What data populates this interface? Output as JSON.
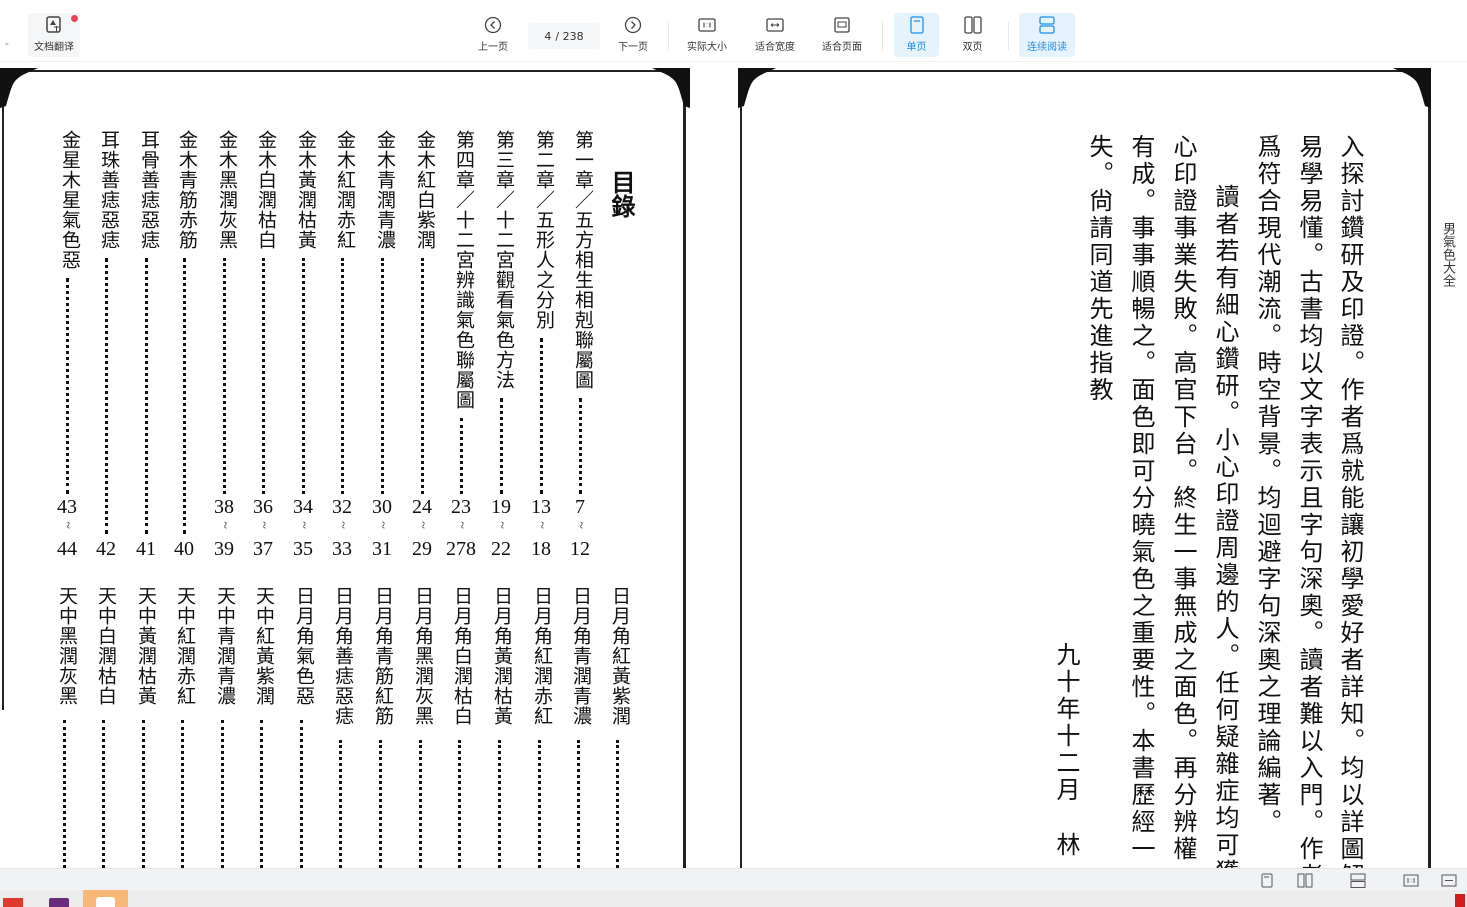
{
  "toolbar": {
    "translate_label": "文档翻译",
    "prev_label": "上一页",
    "current_page": "4",
    "total_pages": "/ 238",
    "next_label": "下一页",
    "actual_size_label": "实际大小",
    "fit_width_label": "适合宽度",
    "fit_page_label": "适合页面",
    "single_page_label": "单页",
    "double_page_label": "双页",
    "continuous_label": "连续阅读",
    "accent_color": "#1f8fe5"
  },
  "left_page": {
    "heading": "目錄",
    "toc_upper": [
      {
        "title": "第一章／五方相生相剋聯屬圖",
        "from": "7",
        "to": "12"
      },
      {
        "title": "第二章／五形人之分別",
        "from": "13",
        "to": "18"
      },
      {
        "title": "第三章／十二宮觀看氣色方法",
        "from": "19",
        "to": "22"
      },
      {
        "title": "第四章／十二宮辨識氣色聯屬圖",
        "from": "23",
        "to": "278"
      },
      {
        "title": "金木紅白紫潤",
        "from": "24",
        "to": "29"
      },
      {
        "title": "金木青潤青濃",
        "from": "30",
        "to": "31"
      },
      {
        "title": "金木紅潤赤紅",
        "from": "32",
        "to": "33"
      },
      {
        "title": "金木黃潤枯黃",
        "from": "34",
        "to": "35"
      },
      {
        "title": "金木白潤枯白",
        "from": "36",
        "to": "37"
      },
      {
        "title": "金木黑潤灰黑",
        "from": "38",
        "to": "39"
      },
      {
        "title": "金木青筋赤筋",
        "from": "",
        "to": "40"
      },
      {
        "title": "耳骨善痣惡痣",
        "from": "",
        "to": "41"
      },
      {
        "title": "耳珠善痣惡痣",
        "from": "",
        "to": "42"
      },
      {
        "title": "金星木星氣色惡",
        "from": "43",
        "to": "44"
      }
    ],
    "toc_lower": [
      {
        "title": "日月角紅黃紫潤"
      },
      {
        "title": "日月角青潤青濃"
      },
      {
        "title": "日月角紅潤赤紅"
      },
      {
        "title": "日月角黃潤枯黃"
      },
      {
        "title": "日月角白潤枯白"
      },
      {
        "title": "日月角黑潤灰黑"
      },
      {
        "title": "日月角青筋紅筋"
      },
      {
        "title": "日月角善痣惡痣"
      },
      {
        "title": "日月角氣色惡"
      },
      {
        "title": "天中紅黃紫潤"
      },
      {
        "title": "天中青潤青濃"
      },
      {
        "title": "天中紅潤赤紅"
      },
      {
        "title": "天中黃潤枯黃"
      },
      {
        "title": "天中白潤枯白"
      },
      {
        "title": "天中黑潤灰黑"
      }
    ]
  },
  "right_page": {
    "running_header": "男氣色大全",
    "columns": [
      "入探討鑽研及印證。作者爲就能讓初學愛好者詳知。均以詳圖解",
      "易學易懂。古書均以文字表示且字句深奧。讀者難以入門。作者",
      "爲符合現代潮流。時空背景。均迴避字句深奧之理論編著。",
      "讀者若有細心鑽研。小心印證周邊的人。任何疑雜症均可獲",
      "心印證事業失敗。高官下台。終生一事無成之面色。再分辨權",
      "有成。事事順暢之。面色即可分曉氣色之重要性。本書歷經一",
      "失。尙請同道先進指教"
    ],
    "date": "九十年十二月",
    "signature": "林"
  }
}
